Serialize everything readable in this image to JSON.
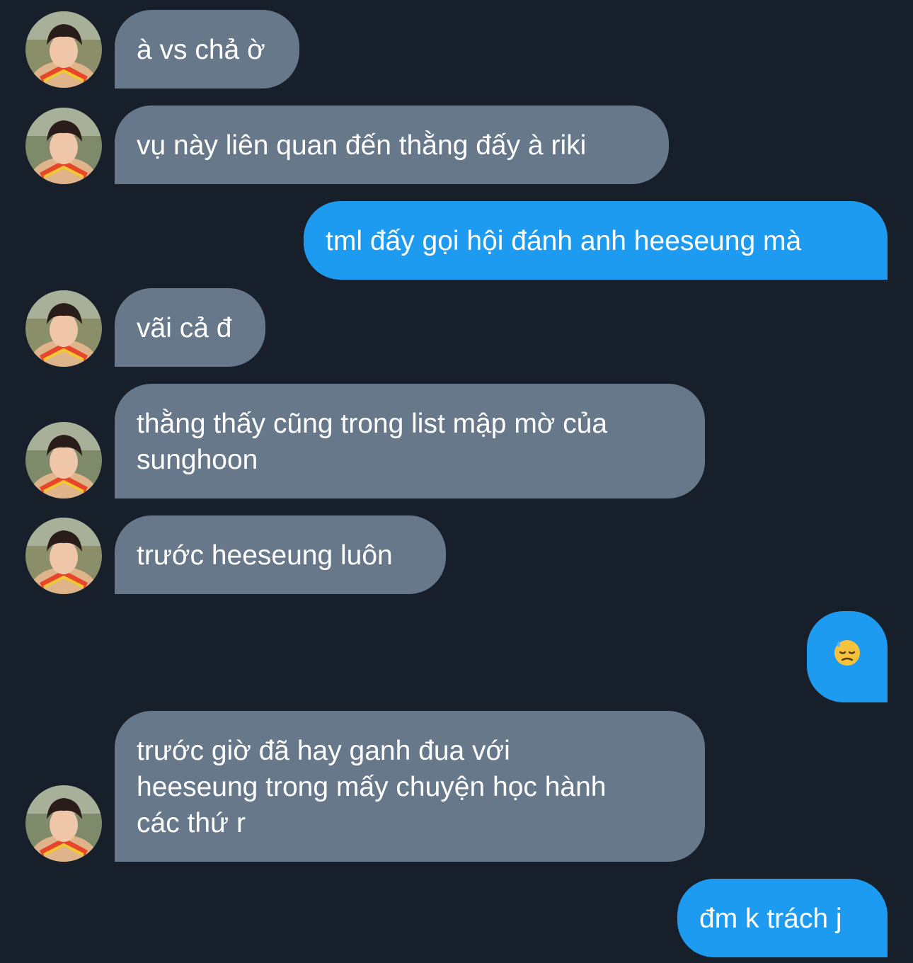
{
  "messages": [
    {
      "id": "m1",
      "side": "in",
      "text": "à vs chả ờ"
    },
    {
      "id": "m2",
      "side": "in",
      "text": "vụ này liên quan đến thằng đấy à riki"
    },
    {
      "id": "m3",
      "side": "out",
      "text": "tml đấy gọi hội đánh anh heeseung mà"
    },
    {
      "id": "m4",
      "side": "in",
      "text": "vãi cả đ"
    },
    {
      "id": "m5",
      "side": "in",
      "lines": [
        "thằng thấy cũng trong list mập mờ của",
        "sunghoon"
      ]
    },
    {
      "id": "m6",
      "side": "in",
      "text": "trước heeseung luôn"
    },
    {
      "id": "m7",
      "side": "out",
      "emoji": "downcast-face-with-sweat"
    },
    {
      "id": "m8",
      "side": "in",
      "lines": [
        "trước giờ đã hay ganh đua với",
        "heeseung trong mấy chuyện học hành",
        "các thứ r"
      ]
    },
    {
      "id": "m9",
      "side": "out",
      "text": "đm k trách j"
    }
  ],
  "colors": {
    "background": "#17202a",
    "incoming_bubble": "#66788a",
    "outgoing_bubble": "#1d9bf0",
    "text": "#ffffff"
  }
}
